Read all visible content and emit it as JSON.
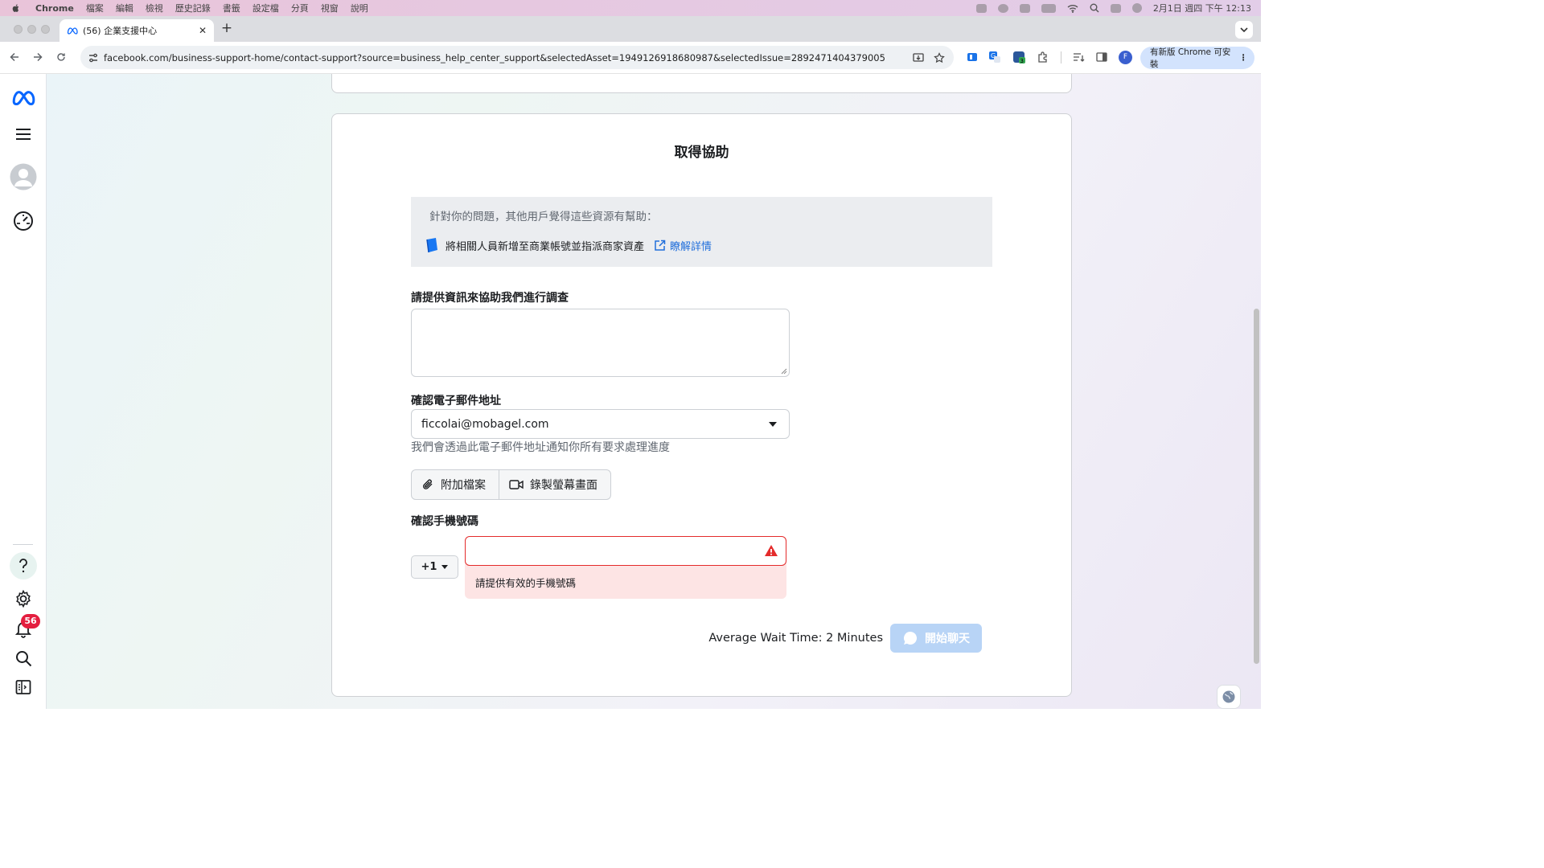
{
  "menubar": {
    "app": "Chrome",
    "items": [
      "檔案",
      "編輯",
      "檢視",
      "歷史記錄",
      "書籤",
      "設定檔",
      "分頁",
      "視窗",
      "說明"
    ],
    "datetime": "2月1日 週四 下午 12:13"
  },
  "tab": {
    "title": "(56) 企業支援中心"
  },
  "toolbar": {
    "url": "facebook.com/business-support-home/contact-support?source=business_help_center_support&selectedAsset=1949126918680987&selectedIssue=2892471404379005",
    "profile_initial": "F",
    "update_label": "有新版 Chrome 可安裝",
    "extension_badge": "3"
  },
  "leftnav": {
    "notification_count": "56"
  },
  "card": {
    "title": "取得協助",
    "resources": {
      "intro": "針對你的問題，其他用戶覺得這些資源有幫助：",
      "item": "將相關人員新增至商業帳號並指派商家資產",
      "link": "瞭解詳情"
    },
    "info_label": "請提供資訊來協助我們進行調查",
    "email_label": "確認電子郵件地址",
    "email_value": "ficcolai@mobagel.com",
    "email_helper": "我們會透過此電子郵件地址通知你所有要求處理進度",
    "attach_label": "附加檔案",
    "record_label": "錄製螢幕畫面",
    "phone_label": "確認手機號碼",
    "country_code": "+1",
    "phone_error": "請提供有效的手機號碼",
    "wait_time": "Average Wait Time: 2 Minutes",
    "chat_label": "開始聊天"
  },
  "colors": {
    "accent": "#216fdb",
    "error": "#e42b2b",
    "badge": "#e41e3f",
    "chat_disabled": "#b8d4f6"
  }
}
